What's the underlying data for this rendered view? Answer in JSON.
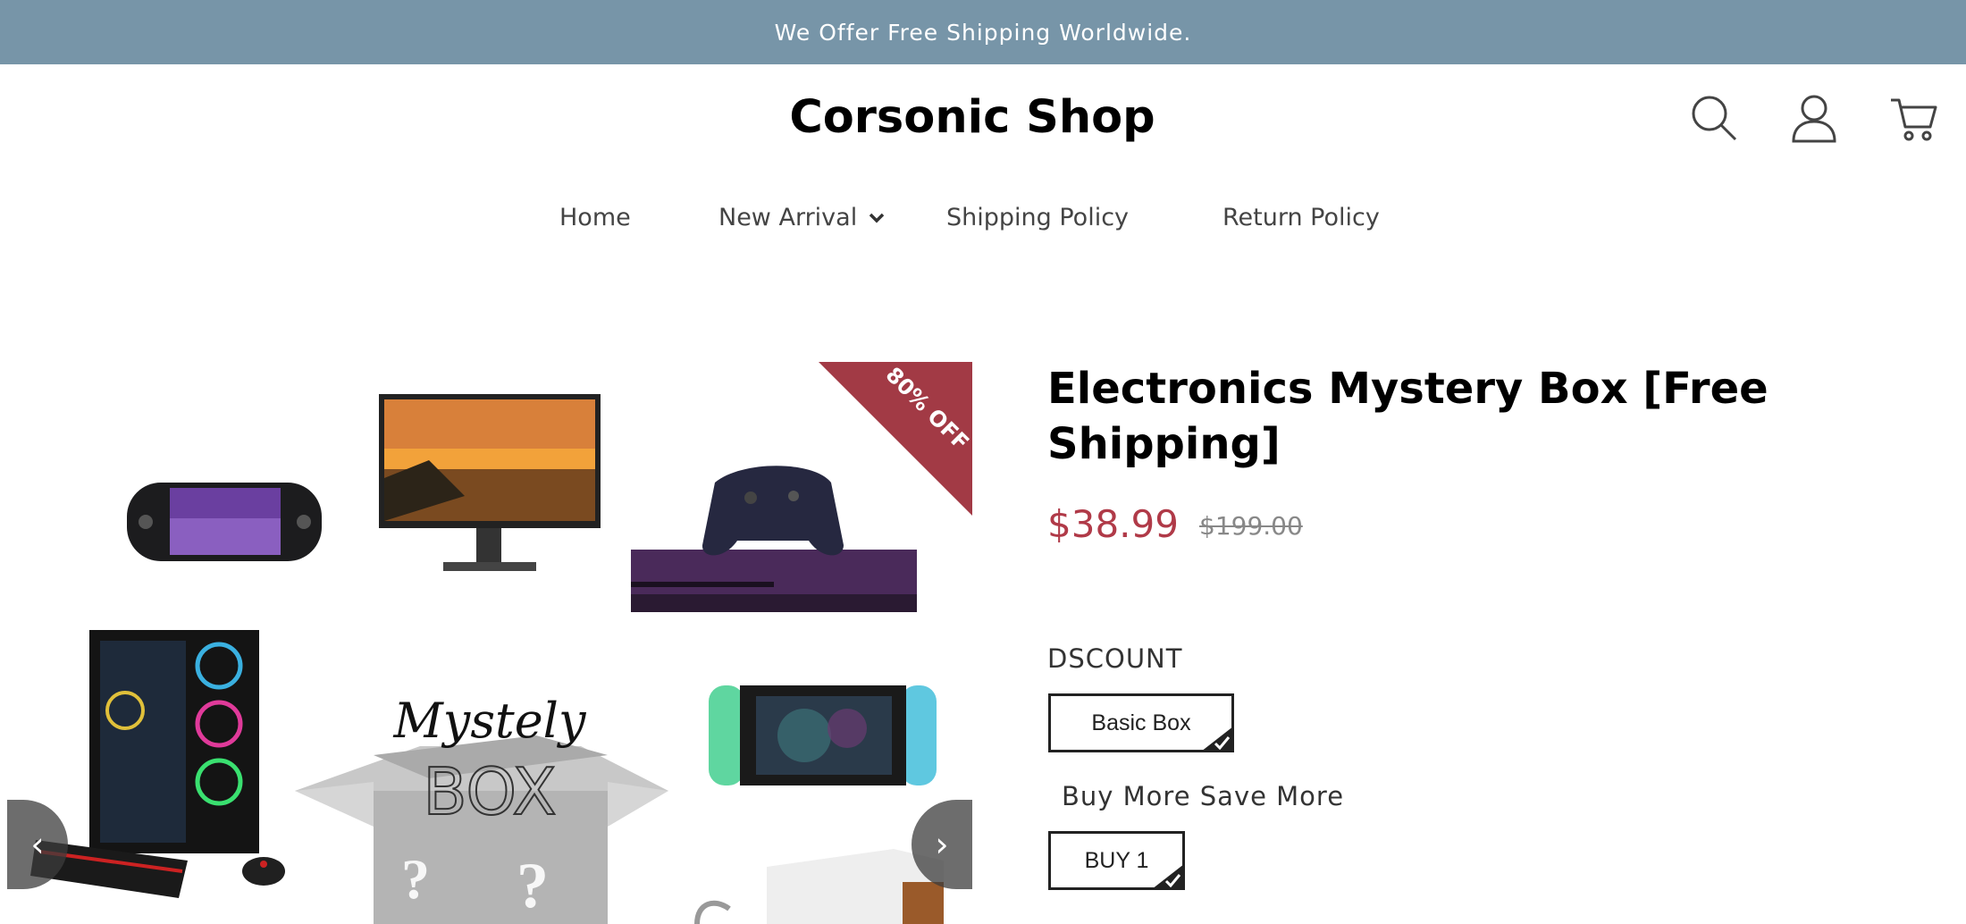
{
  "announcement": "We Offer Free Shipping Worldwide.",
  "header": {
    "logo": "Corsonic Shop",
    "icons": [
      "search-icon",
      "account-icon",
      "cart-icon"
    ]
  },
  "nav": {
    "items": [
      {
        "label": "Home"
      },
      {
        "label": "New Arrival",
        "has_dropdown": true
      },
      {
        "label": "Shipping Policy"
      },
      {
        "label": "Return Policy"
      }
    ]
  },
  "gallery": {
    "badge": "80% OFF",
    "image_text": [
      "Mystely",
      "BOX"
    ],
    "prev_icon": "chevron-left-icon",
    "next_icon": "chevron-right-icon"
  },
  "product": {
    "title": "Electronics Mystery Box [Free Shipping]",
    "price": "$38.99",
    "compare_price": "$199.00",
    "options": [
      {
        "label": "DSCOUNT",
        "selected": "Basic Box"
      },
      {
        "label": "Buy More Save More",
        "selected": "BUY 1"
      }
    ]
  },
  "colors": {
    "announcement_bg": "#7795a8",
    "price": "#b03a48",
    "badge": "#a23a45"
  }
}
